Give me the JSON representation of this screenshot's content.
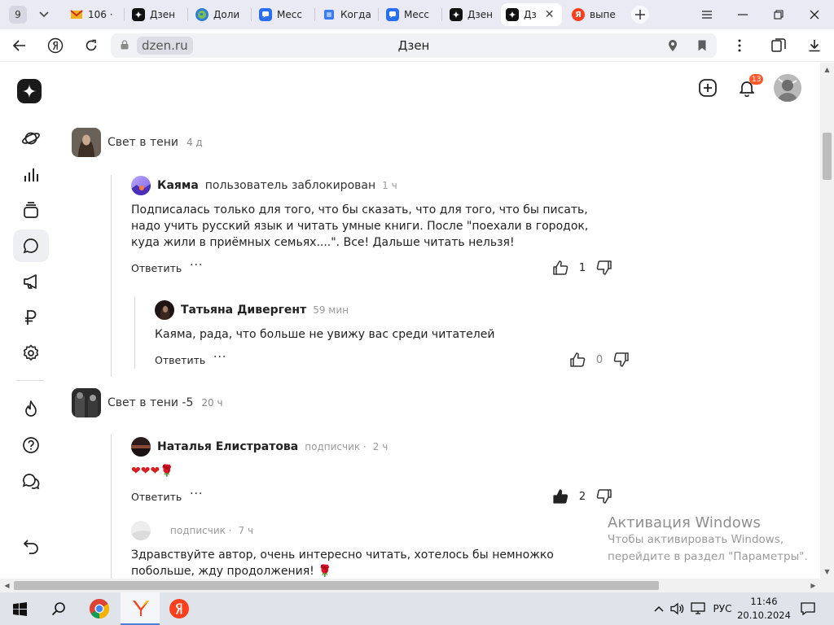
{
  "browser": {
    "tab_count": "9",
    "tabs": [
      {
        "label": "106 ·",
        "icon": "mail-icon",
        "color": "#f2b11c"
      },
      {
        "label": "Дзен",
        "icon": "dzen-icon",
        "color": "#111111"
      },
      {
        "label": "Доли",
        "icon": "globe-icon",
        "color": "#2f7fd6"
      },
      {
        "label": "Месс",
        "icon": "messenger-icon",
        "color": "#2a6ff0"
      },
      {
        "label": "Когда",
        "icon": "cube-icon",
        "color": "#3a7bf2"
      },
      {
        "label": "Месс",
        "icon": "messenger-icon",
        "color": "#2a6ff0"
      },
      {
        "label": "Дзен",
        "icon": "dzen-icon",
        "color": "#111111"
      },
      {
        "label": "Дз",
        "icon": "dzen-icon",
        "color": "#111111",
        "active": true
      },
      {
        "label": "выпе",
        "icon": "yandex-icon",
        "color": "#fc3f1d"
      }
    ],
    "address": {
      "url": "dzen.ru",
      "title": "Дзен"
    }
  },
  "header": {
    "notifications_count": "13"
  },
  "comments": {
    "thread1": {
      "author": "Свет в тени",
      "time": "4 д",
      "reply1": {
        "name": "Каяма",
        "role": "пользователь заблокирован",
        "time": "1 ч",
        "text": "Подписалась только для того, что бы сказать, что для того, что бы писать, надо учить русский язык и читать умные книги. После \"поехали в городок, куда жили в приёмных семьях....\". Все! Дальше читать нельзя!",
        "reply_label": "Ответить",
        "more": "···",
        "likes": "1"
      },
      "reply2": {
        "name": "Татьяна Дивергент",
        "time": "59 мин",
        "text": "Каяма, рада, что больше не увижу вас среди читателей",
        "reply_label": "Ответить",
        "more": "···",
        "likes": "0"
      }
    },
    "thread2": {
      "author": "Свет в тени -5",
      "time": "20 ч",
      "reply1": {
        "name": "Наталья Елистратова",
        "role": "подписчик ·",
        "time": "2 ч",
        "text": "❤❤❤🌹",
        "reply_label": "Ответить",
        "more": "···",
        "likes": "2"
      },
      "reply2": {
        "role": "подписчик ·",
        "time": "7 ч",
        "text": "Здравствуйте автор, очень интересно читать, хотелось бы немножко побольше, жду продолжения! 🌹"
      }
    }
  },
  "watermark": {
    "title": "Активация Windows",
    "line1": "Чтобы активировать Windows,",
    "line2": "перейдите в раздел \"Параметры\"."
  },
  "taskbar": {
    "lang": "РУС",
    "time": "11:46",
    "date": "20.10.2024"
  },
  "colors": {
    "accent_badge": "#ff5a2c",
    "tab_strip": "#e9eaf4",
    "taskbar": "#dfe3ea"
  }
}
